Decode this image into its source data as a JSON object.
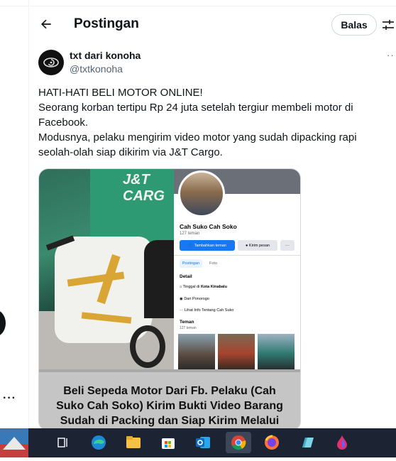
{
  "header": {
    "title": "Postingan",
    "reply_label": "Balas"
  },
  "author": {
    "name": "txt dari konoha",
    "handle": "@txtkonoha"
  },
  "tweet": {
    "lines": [
      "HATI-HATI BELI MOTOR ONLINE!",
      "Seorang korban tertipu Rp 24 juta setelah tergiur membeli motor di Facebook.",
      "Modusnya, pelaku mengirim video motor yang sudah dipacking rapi seolah-olah siap dikirim via J&T Cargo."
    ]
  },
  "media": {
    "photo_sign": "J&T CARG",
    "profile": {
      "name": "Cah Suko Cah Soko",
      "friends": "127 teman",
      "add_friend": "Tambahkan teman",
      "message": "Kirim pesan",
      "more": "···",
      "tab_posts": "Postingan",
      "tab_photos": "Foto",
      "detail_title": "Detail",
      "lives_prefix": "Tinggal di",
      "lives_city": "Kota Kinabalu",
      "from_prefix": "Dari",
      "from_city": "Ponorogo",
      "see_info": "Lihat Info Tentang Cah Suko",
      "friends_title": "Teman",
      "friends_count": "127 teman"
    },
    "caption": "Beli Sepeda Motor Dari Fb. Pelaku (Cah Suko Cah Soko) Kirim Bukti Video Barang Sudah di Packing dan Siap Kirim Melalui J&T Cargo Kepada Pihak..."
  },
  "taskbar": {
    "items": [
      "widgets",
      "task-view",
      "edge",
      "file-explorer",
      "microsoft-store",
      "outlook",
      "chrome",
      "firefox",
      "notepad",
      "app-drop"
    ]
  },
  "colors": {
    "accent_blue": "#1877f2",
    "taskbar_bg": "#1c2433",
    "text_primary": "#0f1419",
    "text_secondary": "#536471"
  }
}
